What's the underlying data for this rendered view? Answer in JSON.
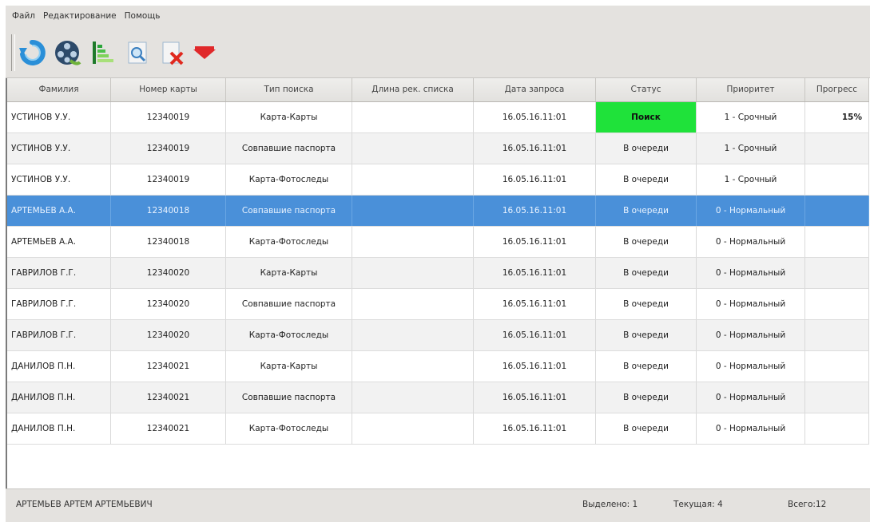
{
  "menu": {
    "items": [
      "Файл",
      "Редактирование",
      "Помощь"
    ]
  },
  "toolbar": {
    "buttons": [
      {
        "icon": "refresh-icon"
      },
      {
        "icon": "film-reel-icon"
      },
      {
        "icon": "sort-bars-icon"
      },
      {
        "icon": "search-document-icon"
      },
      {
        "icon": "delete-document-icon"
      },
      {
        "icon": "red-arrow-down-icon"
      }
    ]
  },
  "table": {
    "columns": [
      "Фамилия",
      "Номер карты",
      "Тип поиска",
      "Длина рек. списка",
      "Дата запроса",
      "Статус",
      "Приоритет",
      "Прогресс"
    ],
    "rows": [
      [
        "УСТИНОВ У.У.",
        "12340019",
        "Карта-Карты",
        "",
        "16.05.16.11:01",
        "Поиск",
        "1 - Срочный",
        "15%"
      ],
      [
        "УСТИНОВ У.У.",
        "12340019",
        "Совпавшие паспорта",
        "",
        "16.05.16.11:01",
        "В очереди",
        "1 - Срочный",
        ""
      ],
      [
        "УСТИНОВ У.У.",
        "12340019",
        "Карта-Фотоследы",
        "",
        "16.05.16.11:01",
        "В очереди",
        "1 - Срочный",
        ""
      ],
      [
        "АРТЕМЬЕВ А.А.",
        "12340018",
        "Совпавшие паспорта",
        "",
        "16.05.16.11:01",
        "В очереди",
        "0 - Нормальный",
        ""
      ],
      [
        "АРТЕМЬЕВ А.А.",
        "12340018",
        "Карта-Фотоследы",
        "",
        "16.05.16.11:01",
        "В очереди",
        "0 - Нормальный",
        ""
      ],
      [
        "ГАВРИЛОВ Г.Г.",
        "12340020",
        "Карта-Карты",
        "",
        "16.05.16.11:01",
        "В очереди",
        "0 - Нормальный",
        ""
      ],
      [
        "ГАВРИЛОВ Г.Г.",
        "12340020",
        "Совпавшие паспорта",
        "",
        "16.05.16.11:01",
        "В очереди",
        "0 - Нормальный",
        ""
      ],
      [
        "ГАВРИЛОВ Г.Г.",
        "12340020",
        "Карта-Фотоследы",
        "",
        "16.05.16.11:01",
        "В очереди",
        "0 - Нормальный",
        ""
      ],
      [
        "ДАНИЛОВ П.Н.",
        "12340021",
        "Карта-Карты",
        "",
        "16.05.16.11:01",
        "В очереди",
        "0 - Нормальный",
        ""
      ],
      [
        "ДАНИЛОВ П.Н.",
        "12340021",
        "Совпавшие паспорта",
        "",
        "16.05.16.11:01",
        "В очереди",
        "0 - Нормальный",
        ""
      ],
      [
        "ДАНИЛОВ П.Н.",
        "12340021",
        "Карта-Фотоследы",
        "",
        "16.05.16.11:01",
        "В очереди",
        "0 - Нормальный",
        ""
      ]
    ],
    "selected_row": 3,
    "status_search_color": "#1fe23a",
    "selection_color": "#4a90d9"
  },
  "statusbar": {
    "user": "АРТЕМЬЕВ АРТЕМ АРТЕМЬЕВИЧ",
    "selected": "Выделено: 1",
    "current": "Текущая: 4",
    "total": "Всего:12"
  }
}
